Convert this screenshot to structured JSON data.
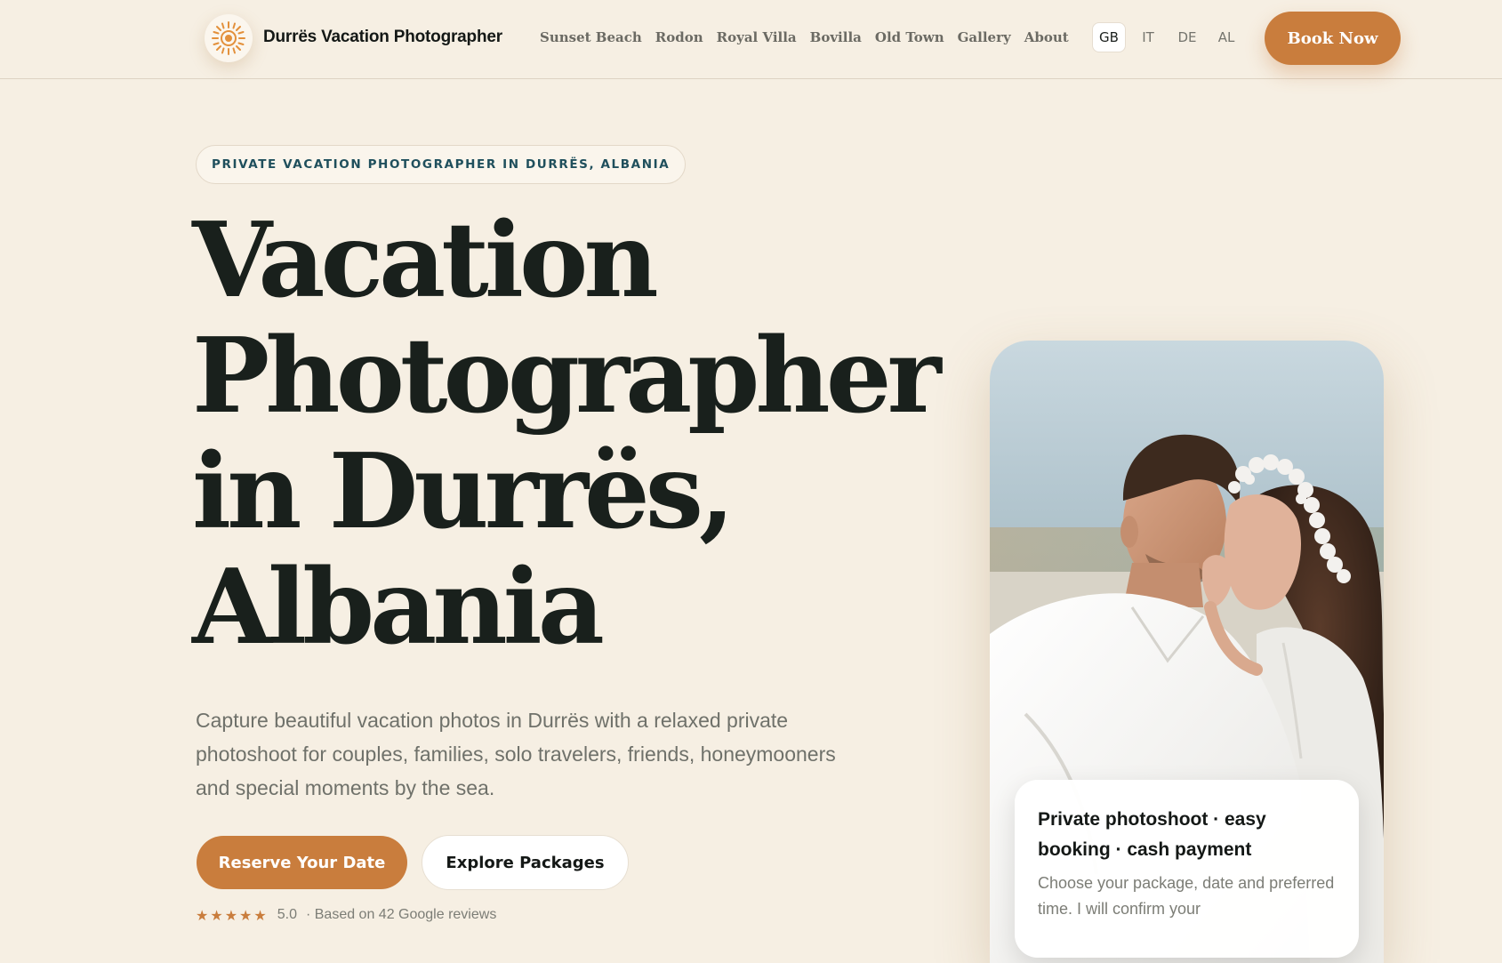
{
  "header": {
    "brand": "Durrës Vacation Photographer",
    "nav": [
      "Sunset Beach",
      "Rodon",
      "Royal Villa",
      "Bovilla",
      "Old Town",
      "Gallery",
      "About"
    ],
    "languages": [
      "GB",
      "IT",
      "DE",
      "AL"
    ],
    "active_language": "GB",
    "book_label": "Book Now"
  },
  "hero": {
    "eyebrow": "PRIVATE VACATION PHOTOGRAPHER IN DURRËS, ALBANIA",
    "headline_lines": [
      "Vacation",
      "Photographer",
      "in Durrës,",
      "Albania"
    ],
    "subtext": "Capture beautiful vacation photos in Durrës with a relaxed private photoshoot for couples, families, solo travelers, friends, honeymooners and special moments by the sea.",
    "primary_cta": "Reserve Your Date",
    "secondary_cta": "Explore Packages",
    "rating_stars": "★★★★★",
    "rating_score": "5.0",
    "rating_text": "· Based on 42 Google reviews"
  },
  "photo_card": {
    "info_title": "Private photoshoot · easy booking · cash payment",
    "info_body": "Choose your package, date and preferred time. I will confirm your"
  },
  "colors": {
    "background": "#f6efe3",
    "accent": "#c97d3d",
    "eyebrow_text": "#1f4f5c",
    "headline": "#19201c"
  },
  "icons": {
    "logo": "sun-icon",
    "rating": "star-icon"
  }
}
